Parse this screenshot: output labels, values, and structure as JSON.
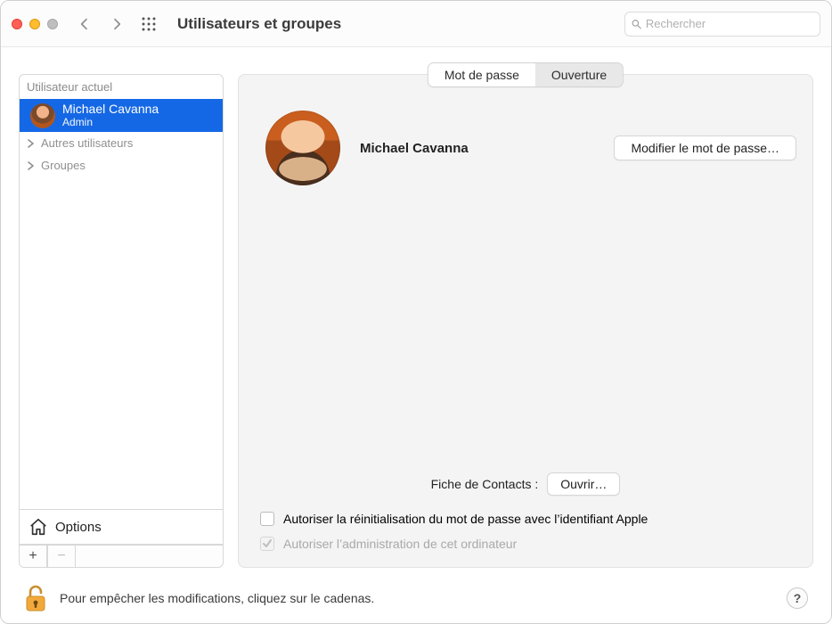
{
  "window": {
    "title": "Utilisateurs et groupes"
  },
  "search": {
    "placeholder": "Rechercher",
    "value": ""
  },
  "sidebar": {
    "current_user_header": "Utilisateur actuel",
    "user": {
      "name": "Michael Cavanna",
      "role": "Admin"
    },
    "items": [
      {
        "label": "Autres utilisateurs"
      },
      {
        "label": "Groupes"
      }
    ],
    "options_label": "Options",
    "add_label": "+",
    "remove_label": "−"
  },
  "tabs": {
    "password": "Mot de passe",
    "login": "Ouverture"
  },
  "main": {
    "user_name": "Michael Cavanna",
    "change_password_button": "Modifier le mot de passe…",
    "contacts_label": "Fiche de Contacts :",
    "open_button": "Ouvrir…",
    "allow_reset_label": "Autoriser la réinitialisation du mot de passe avec l’identifiant Apple",
    "allow_admin_label": "Autoriser l’administration de cet ordinateur"
  },
  "footer": {
    "lock_message": "Pour empêcher les modifications, cliquez sur le cadenas.",
    "help_label": "?"
  }
}
